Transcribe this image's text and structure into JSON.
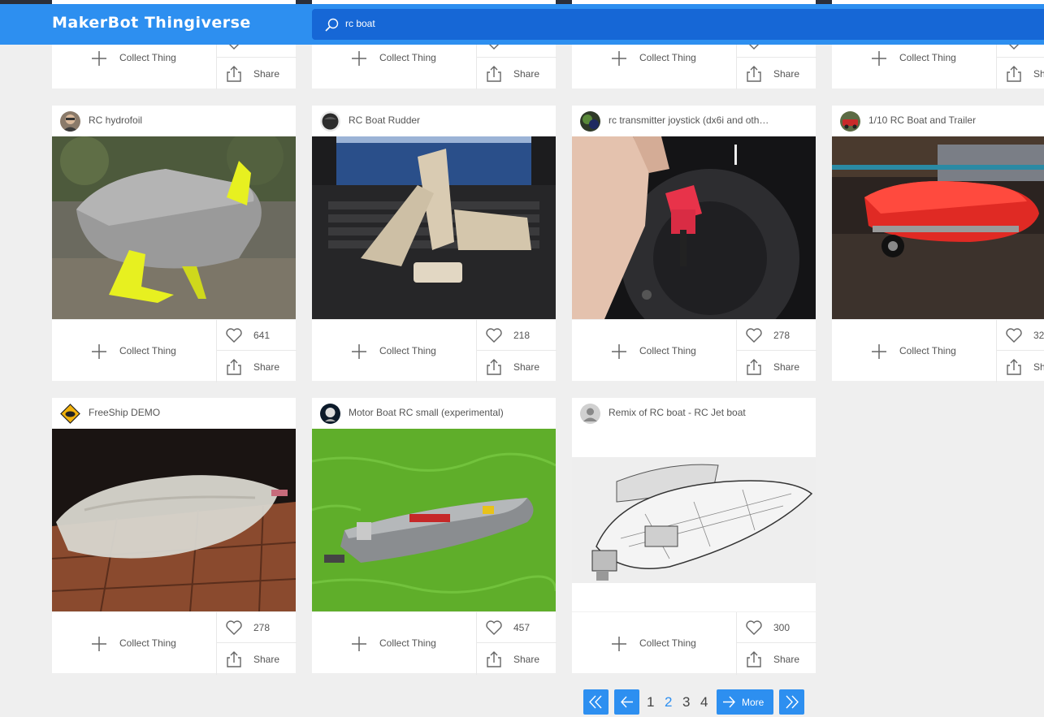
{
  "header": {
    "brand": "MakerBot Thingiverse",
    "search_value": "rc boat"
  },
  "labels": {
    "collect": "Collect Thing",
    "share": "Share",
    "share_partial": "Sh"
  },
  "top_row": [
    {},
    {},
    {},
    {}
  ],
  "cards": [
    {
      "title": "RC hydrofoil",
      "likes": "641"
    },
    {
      "title": "RC Boat Rudder",
      "likes": "218"
    },
    {
      "title": "rc transmitter joystick (dx6i and oth…",
      "likes": "278"
    },
    {
      "title": "1/10 RC Boat and Trailer",
      "likes": "32"
    },
    {
      "title": "FreeShip DEMO",
      "likes": "278"
    },
    {
      "title": "Motor Boat RC small (experimental)",
      "likes": "457"
    },
    {
      "title": "Remix of RC boat - RC Jet boat",
      "likes": "300"
    }
  ],
  "pagination": {
    "pages": [
      "1",
      "2",
      "3",
      "4"
    ],
    "current": "2",
    "more": "More"
  },
  "colors": {
    "header": "#2d8ff0",
    "search": "#1667d6",
    "accent": "#2d8ff0"
  }
}
